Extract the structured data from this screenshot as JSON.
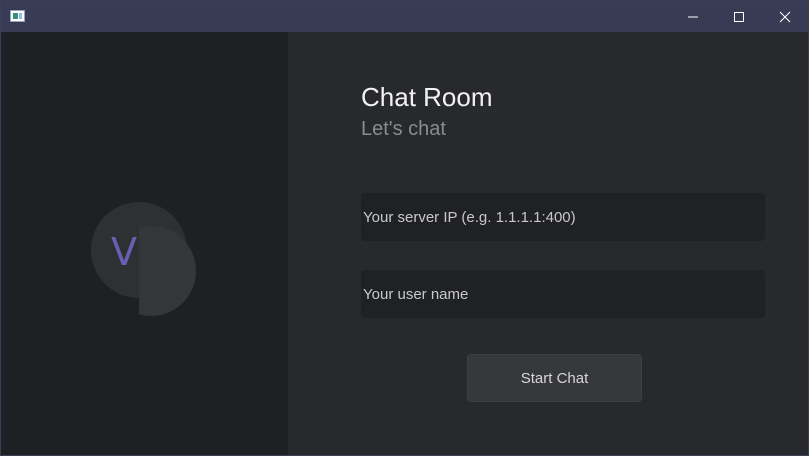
{
  "window": {
    "app_icon": "window-app-icon",
    "controls": {
      "minimize_icon": "minimize-icon",
      "maximize_icon": "maximize-icon",
      "close_icon": "close-icon"
    }
  },
  "brand": {
    "logo_letter": "V",
    "accent_color": "#6b5fb3"
  },
  "main": {
    "title": "Chat Room",
    "subtitle": "Let's chat",
    "server_ip": {
      "value": "",
      "placeholder": "Your server IP (e.g. 1.1.1.1:400)"
    },
    "user_name": {
      "value": "",
      "placeholder": "Your user name"
    },
    "start_button_label": "Start Chat"
  }
}
